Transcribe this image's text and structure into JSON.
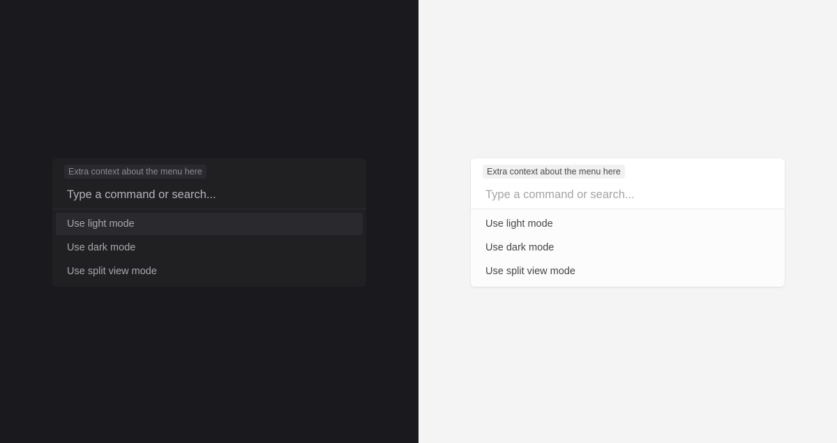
{
  "dark_pane": {
    "context": "Extra context about the menu here",
    "search_placeholder": "Type a command or search...",
    "items": [
      {
        "label": "Use light mode"
      },
      {
        "label": "Use dark mode"
      },
      {
        "label": "Use split view mode"
      }
    ]
  },
  "light_pane": {
    "context": "Extra context about the menu here",
    "search_placeholder": "Type a command or search...",
    "items": [
      {
        "label": "Use light mode"
      },
      {
        "label": "Use dark mode"
      },
      {
        "label": "Use split view mode"
      }
    ]
  },
  "colors": {
    "dark_background": "#1a191e",
    "dark_menu": "#202023",
    "light_background": "#f4f4f4",
    "light_menu": "#ffffff"
  }
}
